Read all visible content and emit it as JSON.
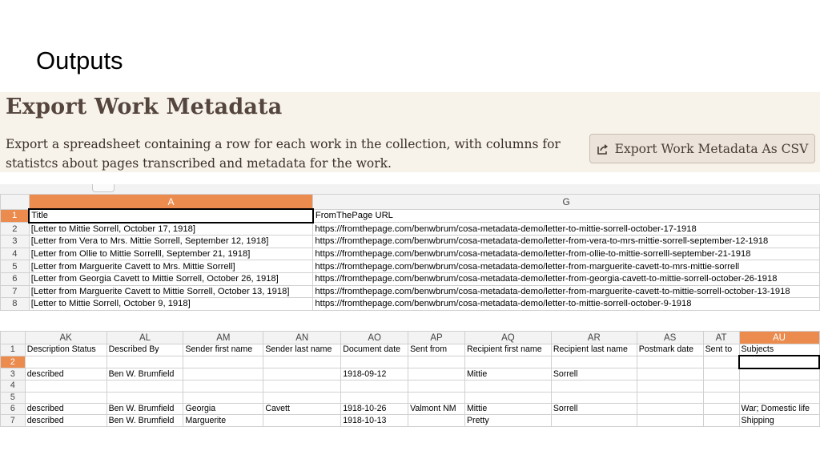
{
  "slide": {
    "title": "Outputs"
  },
  "panel": {
    "heading": "Export Work Metadata",
    "description": "Export a spreadsheet containing a row for each work in the collection, with columns for statistcs about pages transcribed and metadata for the work.",
    "button_label": "Export Work Metadata As CSV",
    "button_icon": "export-icon"
  },
  "sheet1": {
    "columns": [
      "A",
      "G"
    ],
    "active_column": "A",
    "rows": [
      {
        "n": "1",
        "a": "Title",
        "g": "FromThePage URL"
      },
      {
        "n": "2",
        "a": "[Letter to Mittie Sorrell, October 17, 1918]",
        "g": "https://fromthepage.com/benwbrum/cosa-metadata-demo/letter-to-mittie-sorrell-october-17-1918"
      },
      {
        "n": "3",
        "a": "[Letter from Vera to Mrs. Mittie Sorrell, September 12, 1918]",
        "g": "https://fromthepage.com/benwbrum/cosa-metadata-demo/letter-from-vera-to-mrs-mittie-sorrell-september-12-1918"
      },
      {
        "n": "4",
        "a": "[Letter from Ollie to Mittie Sorrelll, September 21, 1918]",
        "g": "https://fromthepage.com/benwbrum/cosa-metadata-demo/letter-from-ollie-to-mittie-sorrelll-september-21-1918"
      },
      {
        "n": "5",
        "a": "[Letter from Marguerite Cavett to Mrs. Mittie Sorrell]",
        "g": "https://fromthepage.com/benwbrum/cosa-metadata-demo/letter-from-marguerite-cavett-to-mrs-mittie-sorrell"
      },
      {
        "n": "6",
        "a": "[Letter from Georgia Cavett to Mittie Sorrell, October 26, 1918]",
        "g": "https://fromthepage.com/benwbrum/cosa-metadata-demo/letter-from-georgia-cavett-to-mittie-sorrell-october-26-1918"
      },
      {
        "n": "7",
        "a": "[Letter from Marguerite Cavett to Mittie Sorrell, October 13, 1918]",
        "g": "https://fromthepage.com/benwbrum/cosa-metadata-demo/letter-from-marguerite-cavett-to-mittie-sorrell-october-13-1918"
      },
      {
        "n": "8",
        "a": "[Letter to Mittie Sorrell, October 9, 1918]",
        "g": "https://fromthepage.com/benwbrum/cosa-metadata-demo/letter-to-mittie-sorrell-october-9-1918"
      }
    ]
  },
  "sheet2": {
    "columns": [
      "AK",
      "AL",
      "AM",
      "AN",
      "AO",
      "AP",
      "AQ",
      "AR",
      "AS",
      "AT",
      "AU"
    ],
    "active_column": "AU",
    "rows": [
      {
        "n": "1",
        "cells": [
          "Description Status",
          "Described By",
          "Sender first name",
          "Sender last name",
          "Document date",
          "Sent from",
          "Recipient first name",
          "Recipient last name",
          "Postmark date",
          "Sent to",
          "Subjects"
        ]
      },
      {
        "n": "2",
        "cells": [
          "",
          "",
          "",
          "",
          "",
          "",
          "",
          "",
          "",
          "",
          ""
        ]
      },
      {
        "n": "3",
        "cells": [
          "described",
          "Ben W. Brumfield",
          "",
          "",
          "1918-09-12",
          "",
          "Mittie",
          "Sorrell",
          "",
          "",
          ""
        ]
      },
      {
        "n": "4",
        "cells": [
          "",
          "",
          "",
          "",
          "",
          "",
          "",
          "",
          "",
          "",
          ""
        ]
      },
      {
        "n": "5",
        "cells": [
          "",
          "",
          "",
          "",
          "",
          "",
          "",
          "",
          "",
          "",
          ""
        ]
      },
      {
        "n": "6",
        "cells": [
          "described",
          "Ben W. Brumfield",
          "Georgia",
          "Cavett",
          "1918-10-26",
          "Valmont NM",
          "Mittie",
          "Sorrell",
          "",
          "",
          "War; Domestic life"
        ]
      },
      {
        "n": "7",
        "cells": [
          "described",
          "Ben W. Brumfield",
          "Marguerite",
          "",
          "1918-10-13",
          "",
          "Pretty",
          "",
          "",
          "",
          "Shipping"
        ]
      }
    ]
  }
}
